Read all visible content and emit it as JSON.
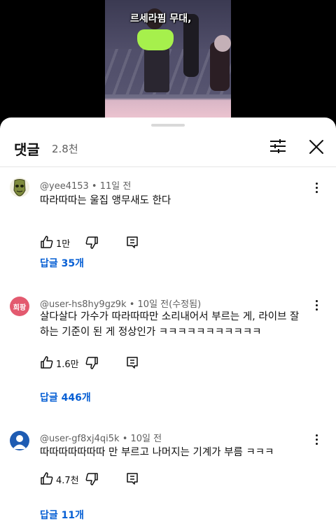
{
  "video": {
    "caption": "르세라핌 무대,"
  },
  "comments_panel": {
    "title": "댓글",
    "count": "2.8천"
  },
  "comments": [
    {
      "author": "@yee4153",
      "time": "11일 전",
      "text": "따라따따는 울집 앵무새도 한다",
      "likes": "1만",
      "replies_label": "답글 35개",
      "avatar_icon": "green-mask-avatar"
    },
    {
      "author": "@user-hs8hy9gz9k",
      "time": "10일 전(수정됨)",
      "text": "살다살다 가수가 따라따따만 소리내어서 부르는 게, 라이브 잘하는 기준이 된 게 정상인가 ㅋㅋㅋㅋㅋㅋㅋㅋㅋㅋㅋ",
      "likes": "1.6만",
      "replies_label": "답글 446개",
      "avatar_text": "희팡"
    },
    {
      "author": "@user-gf8xj4qi5k",
      "time": "10일 전",
      "text": "따따따따따따따 만 부르고 나머지는 기계가 부름 ㅋㅋㅋ",
      "likes": "4.7천",
      "replies_label": "답글 11개",
      "avatar_icon": "default-person-avatar"
    }
  ],
  "meta_separator": "•",
  "colors": {
    "link_blue": "#065fd4",
    "text_primary": "#0f0f0f",
    "text_secondary": "#606060",
    "avatar_pink": "#e35a6f",
    "avatar_blue": "#1e5cb3"
  }
}
